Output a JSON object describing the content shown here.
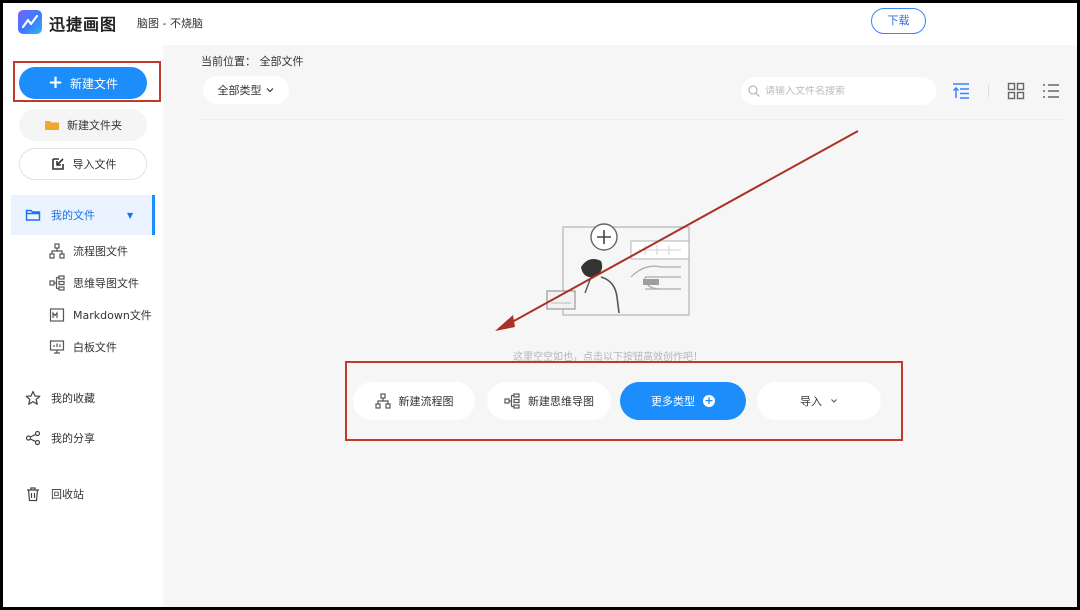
{
  "app": {
    "brand": "迅捷画图",
    "doc_title": "脑图 - 不烧脑",
    "download_label": "下载"
  },
  "sidebar": {
    "new_file_label": "新建文件",
    "new_folder_label": "新建文件夹",
    "import_label": "导入文件",
    "my_files_label": "我的文件",
    "sub_items": [
      {
        "label": "流程图文件",
        "icon": "flowchart-icon"
      },
      {
        "label": "思维导图文件",
        "icon": "mindmap-icon"
      },
      {
        "label": "Markdown文件",
        "icon": "markdown-icon"
      },
      {
        "label": "白板文件",
        "icon": "whiteboard-icon"
      }
    ],
    "nav": [
      {
        "label": "我的收藏",
        "icon": "star-icon"
      },
      {
        "label": "我的分享",
        "icon": "share-icon"
      },
      {
        "label": "回收站",
        "icon": "trash-icon"
      }
    ]
  },
  "main": {
    "breadcrumb": "当前位置： 全部文件",
    "type_filter": "全部类型",
    "search_placeholder": "请输入文件名搜索",
    "empty_hint": "这里空空如也，点击以下按钮高效创作吧！",
    "actions": {
      "new_flowchart": "新建流程图",
      "new_mindmap": "新建思维导图",
      "more_types": "更多类型",
      "import": "导入"
    }
  },
  "colors": {
    "accent": "#1c8dfb",
    "annotation": "#c0392b"
  }
}
